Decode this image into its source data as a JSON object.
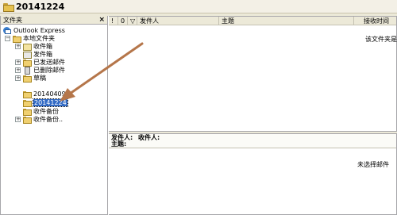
{
  "window": {
    "title": "20141224"
  },
  "folder_pane": {
    "header": "文件夹",
    "close_glyph": "×",
    "tree": [
      {
        "label": "Outlook Express",
        "icon": "outlook-express-icon",
        "expander": ""
      },
      {
        "label": "本地文件夹",
        "icon": "local-folders-icon",
        "expander": "−"
      },
      {
        "label": "收件箱",
        "icon": "inbox-icon",
        "expander": "+"
      },
      {
        "label": "发件箱",
        "icon": "outbox-icon",
        "expander": ""
      },
      {
        "label": "已发送邮件",
        "icon": "sent-items-icon",
        "expander": "+"
      },
      {
        "label": "已删除邮件",
        "icon": "deleted-items-icon",
        "expander": "+"
      },
      {
        "label": "草稿",
        "icon": "drafts-icon",
        "expander": "+"
      },
      {
        "label": "20140409",
        "icon": "folder-icon",
        "expander": ""
      },
      {
        "label": "20141224",
        "icon": "folder-icon",
        "expander": "",
        "selected": true
      },
      {
        "label": "收件备份",
        "icon": "folder-icon",
        "expander": ""
      },
      {
        "label": "收件备份..",
        "icon": "folder-icon",
        "expander": "+"
      }
    ]
  },
  "message_list": {
    "columns": {
      "priority": "!",
      "attachment": "0",
      "flag": "▽",
      "from": "发件人",
      "subject": "主题",
      "received": "接收时间"
    },
    "empty_text": "该文件夹是"
  },
  "preview_pane": {
    "from_label": "发件人:",
    "to_label": "收件人:",
    "subject_label": "主题:",
    "empty_text": "未选择邮件"
  },
  "annotation": {
    "arrow_color": "#b5764a"
  }
}
